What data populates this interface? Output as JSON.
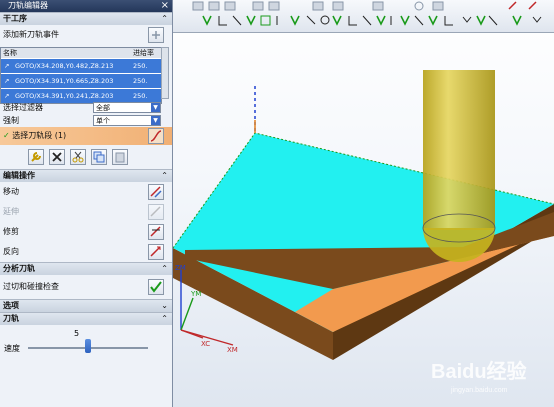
{
  "dialog": {
    "title": "刀轨编辑器",
    "close_glyph": "×",
    "sections": {
      "work": "干工序",
      "edit": "编辑操作",
      "analyze": "分析刀轨",
      "more": "选项",
      "speed": "刀轨"
    },
    "add_event_label": "添加新刀轨事件",
    "table": {
      "col_name": "名称",
      "col_feed": "进给率",
      "rows": [
        {
          "name": "GOTO/X34.208,Y0.482,Z8.213",
          "feed": "250."
        },
        {
          "name": "GOTO/X34.391,Y0.665,Z8.203",
          "feed": "250."
        },
        {
          "name": "GOTO/X34.391,Y0.241,Z8.203",
          "feed": "250."
        }
      ]
    },
    "filter_label": "选择过滤器",
    "filter_value": "全部",
    "scope_label": "强制",
    "scope_value": "单个",
    "select_label": "选择刀轨段",
    "select_count": "(1)",
    "edit_items": [
      {
        "label": "移动"
      },
      {
        "label": "延伸"
      },
      {
        "label": "修剪"
      },
      {
        "label": "反向"
      }
    ],
    "gouge_label": "过切和碰撞检查",
    "slider_label": "速度",
    "slider_value": "5",
    "slider_fraction": 0.5
  },
  "viewport": {
    "axis_labels": {
      "xc": "XC",
      "xm": "XM",
      "ym": "YM",
      "zm": "ZM",
      "zc": "ZC"
    },
    "colors": {
      "top": "#22f0f0",
      "side": "#7a4a1c",
      "orange": "#f29a4e",
      "tool": "#c8b628"
    },
    "watermark": "Baidu经验",
    "watermark_sub": "jingyan.baidu.com"
  }
}
